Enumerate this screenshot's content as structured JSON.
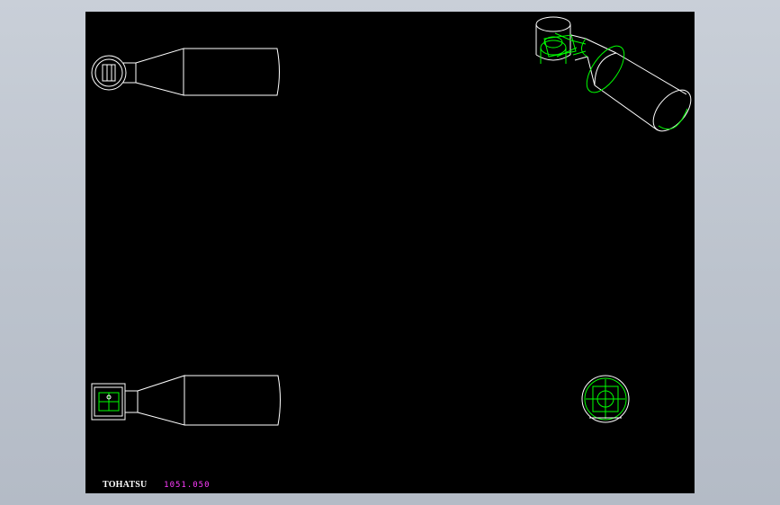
{
  "drawing": {
    "brand": "TOHATSU",
    "part_number": "1051.050"
  },
  "colors": {
    "background": "#000000",
    "outline": "#ffffff",
    "detail": "#00ff00",
    "part_number": "#ff3cff"
  },
  "views": [
    {
      "name": "top-view",
      "shape": "handle-grip-with-ring-end"
    },
    {
      "name": "isometric-view",
      "shape": "handle-grip-with-ring-end"
    },
    {
      "name": "side-view",
      "shape": "handle-grip-with-square-end"
    },
    {
      "name": "end-view",
      "shape": "circle"
    }
  ]
}
